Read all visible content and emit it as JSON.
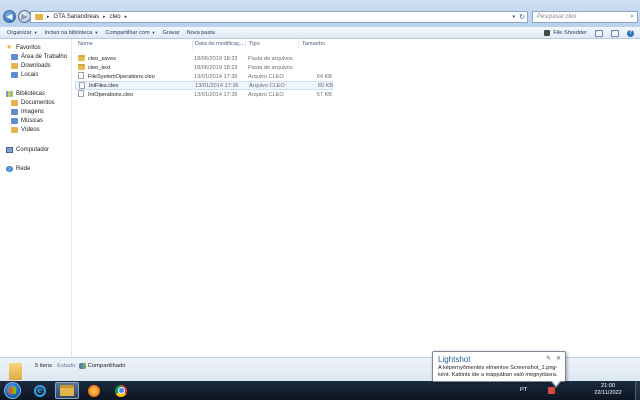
{
  "address_bar": {
    "breadcrumbs": [
      "GTA Sanandreas",
      "cleo"
    ],
    "search_placeholder": "Pesquisar cleo"
  },
  "toolbar": {
    "organize": "Organizar",
    "include_in_library": "Incluir na biblioteca",
    "share_with": "Compartilhar com",
    "burn": "Gravar",
    "new_folder": "Nova pasta",
    "file_shredder": "File Shredder"
  },
  "nav": {
    "favorites": "Favoritos",
    "desktop": "Área de Trabalho",
    "downloads": "Downloads",
    "recent": "Locais",
    "libraries": "Bibliotecas",
    "documents": "Documentos",
    "images": "Imagens",
    "music": "Músicas",
    "videos": "Vídeos",
    "computer": "Computador",
    "network": "Rede"
  },
  "columns": {
    "name": "Nome",
    "date": "Data de modificaç...",
    "type": "Tipo",
    "size": "Tamanho"
  },
  "files": [
    {
      "name": "cleo_saves",
      "date": "18/06/2019 18:23",
      "type": "Pasta de arquivos",
      "size": "",
      "icon": "folder-icon"
    },
    {
      "name": "cleo_text",
      "date": "18/06/2019 18:23",
      "type": "Pasta de arquivos",
      "size": "",
      "icon": "folder-icon"
    },
    {
      "name": "FileSystemOperations.cleo",
      "date": "13/01/2014 17:36",
      "type": "Arquivo CLEO",
      "size": "64 KB",
      "icon": "file-icon"
    },
    {
      "name": "IniFiles.cleo",
      "date": "13/01/2014 17:36",
      "type": "Arquivo CLEO",
      "size": "80 KB",
      "icon": "file-icon"
    },
    {
      "name": "IntOperations.cleo",
      "date": "13/01/2014 17:36",
      "type": "Arquivo CLEO",
      "size": "57 KB",
      "icon": "file-icon"
    }
  ],
  "details": {
    "item_count": "5 itens",
    "state_label": "Estado:",
    "state_value": "Compartilhado"
  },
  "balloon": {
    "title": "Lightshot",
    "text": "A képernyőmentés elmentve Screenshot_1.png-ként. Kattints ide a mappában való megnyitásra."
  },
  "taskbar": {
    "language": "PT",
    "time": "21:00",
    "date": "22/11/2022"
  }
}
